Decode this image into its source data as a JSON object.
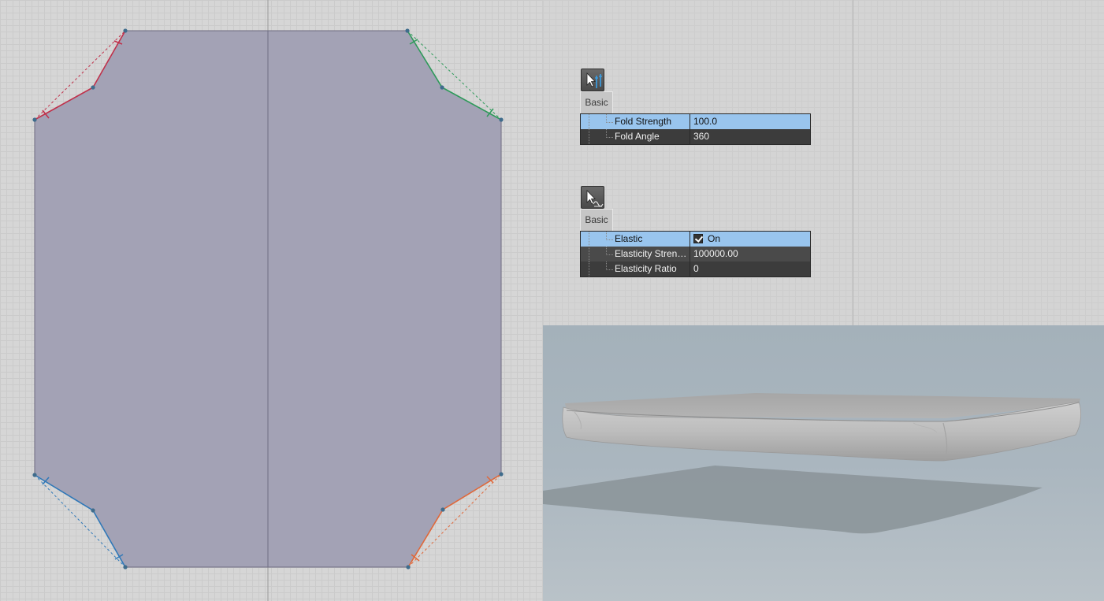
{
  "pattern_view": {
    "segments": [
      {
        "name": "top-left-fold",
        "color": "#c0304a"
      },
      {
        "name": "top-right-fold",
        "color": "#2e9a5a"
      },
      {
        "name": "bottom-left-fold",
        "color": "#2f78b8"
      },
      {
        "name": "bottom-right-fold",
        "color": "#e0683a"
      }
    ]
  },
  "fold_panel": {
    "icon": "fold-tool-icon",
    "tab_label": "Basic",
    "rows": [
      {
        "name": "Fold Strength",
        "value": "100.0",
        "selected": true
      },
      {
        "name": "Fold Angle",
        "value": "360",
        "selected": false
      }
    ]
  },
  "elastic_panel": {
    "icon": "elastic-tool-icon",
    "tab_label": "Basic",
    "rows": [
      {
        "name": "Elastic",
        "value": "On",
        "selected": true,
        "checkbox": true
      },
      {
        "name": "Elasticity Stren…",
        "value": "100000.00",
        "selected": false
      },
      {
        "name": "Elasticity Ratio",
        "value": "0",
        "selected": false
      }
    ]
  },
  "colors": {
    "selection": "#99c5ee",
    "pattern_fill": "#a09fb3",
    "viewport_3d_bg": "#a9b5be"
  }
}
